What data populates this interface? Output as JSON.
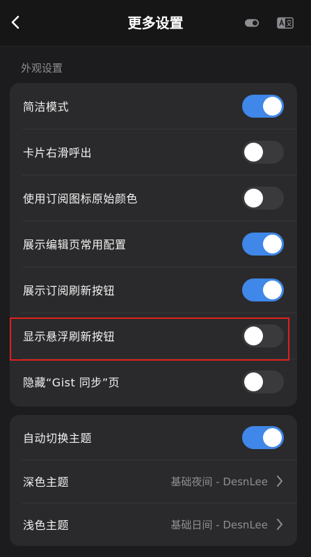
{
  "header": {
    "title": "更多设置",
    "back_icon": "chevron-left-icon",
    "right_icons": [
      "toggle-icon",
      "translate-icon"
    ]
  },
  "appearance": {
    "section_title": "外观设置",
    "items": [
      {
        "label": "简洁模式",
        "on": true
      },
      {
        "label": "卡片右滑呼出",
        "on": false
      },
      {
        "label": "使用订阅图标原始颜色",
        "on": false
      },
      {
        "label": "展示编辑页常用配置",
        "on": true
      },
      {
        "label": "展示订阅刷新按钮",
        "on": true
      },
      {
        "label": "显示悬浮刷新按钮",
        "on": false
      },
      {
        "label": "隐藏“Gist 同步”页",
        "on": false
      }
    ]
  },
  "theme": {
    "auto_switch": {
      "label": "自动切换主题",
      "on": true
    },
    "dark": {
      "label": "深色主题",
      "value": "基础夜间 - DesnLee"
    },
    "light": {
      "label": "浅色主题",
      "value": "基础日间 - DesnLee"
    }
  },
  "colors": {
    "accent": "#3f87e8",
    "highlight": "#e0201a",
    "background": "#1c1c1e",
    "card": "#2a2a2c"
  }
}
